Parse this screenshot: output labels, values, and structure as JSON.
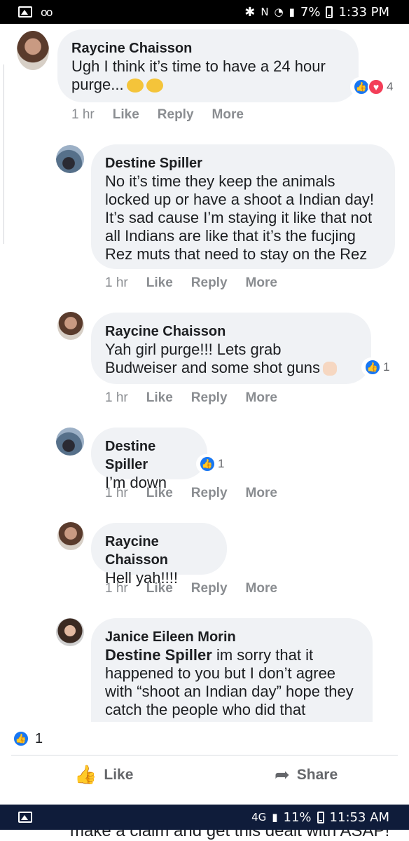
{
  "status_top": {
    "battery": "7%",
    "time": "1:33 PM"
  },
  "status_bottom": {
    "network": "4G",
    "battery": "11%",
    "time": "11:53 AM"
  },
  "comments": [
    {
      "name": "Raycine Chaisson",
      "text": "Ugh I think it’s time to have a 24 hour purge...",
      "time": "1 hr",
      "like": "Like",
      "reply": "Reply",
      "more": "More",
      "reaction_count": "4"
    },
    {
      "name": "Destine Spiller",
      "text": "No it’s time they keep the animals locked up or have a shoot a Indian day! It’s sad cause I’m staying it like that not all Indians are like that it’s the fucjing Rez muts that need to stay on the Rez",
      "time": "1 hr",
      "like": "Like",
      "reply": "Reply",
      "more": "More"
    },
    {
      "name": "Raycine Chaisson",
      "text": "Yah girl purge!!! Lets grab Budweiser and some shot guns",
      "time": "1 hr",
      "like": "Like",
      "reply": "Reply",
      "more": "More",
      "reaction_count": "1"
    },
    {
      "name": "Destine Spiller",
      "text": "I’m down",
      "time": "1 hr",
      "like": "Like",
      "reply": "Reply",
      "more": "More",
      "reaction_count": "1"
    },
    {
      "name": "Raycine Chaisson",
      "text": "Hell yah!!!!",
      "time": "1 hr",
      "like": "Like",
      "reply": "Reply",
      "more": "More"
    },
    {
      "name": "Janice Eileen Morin",
      "mention": "Destine Spiller",
      "text": "im sorry that it happened to you but I don’t agree with “shoot an Indian day” hope they catch the people who did that"
    }
  ],
  "footer": {
    "like_count": "1",
    "like_label": "Like",
    "share_label": "Share"
  },
  "clipped_text": "make a claim and get this dealt with ASAP!",
  "colors": {
    "like_blue": "#1877f2",
    "love_red": "#f33e58",
    "bubble_gray": "#f0f2f5"
  }
}
